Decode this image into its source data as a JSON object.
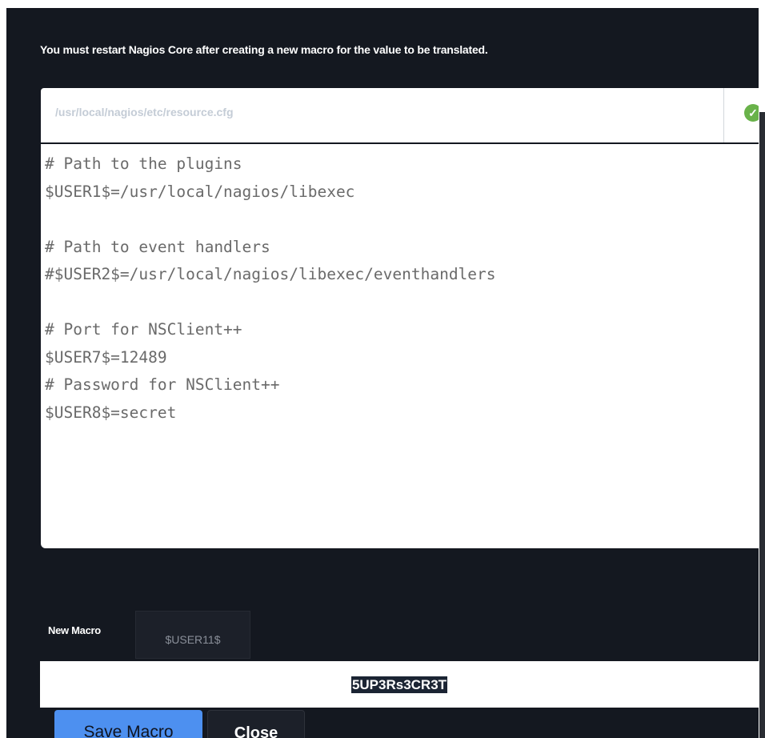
{
  "notice": "You must restart Nagios Core after creating a new macro for the value to be translated.",
  "resource_file": {
    "path": "/usr/local/nagios/etc/resource.cfg",
    "status_icon": "check-circle-icon",
    "status_color": "#69b24a"
  },
  "editor": {
    "lines": [
      "# Path to the plugins",
      "$USER1$=/usr/local/nagios/libexec",
      "",
      "# Path to event handlers",
      "#$USER2$=/usr/local/nagios/libexec/eventhandlers",
      "",
      "# Port for NSClient++",
      "$USER7$=12489",
      "# Password for NSClient++",
      "$USER8$=secret"
    ]
  },
  "new_macro": {
    "label": "New Macro",
    "name": "$USER11$",
    "value": "5UP3Rs3CR3T"
  },
  "buttons": {
    "save": "Save Macro",
    "close": "Close"
  },
  "colors": {
    "panel_bg": "#141820",
    "accent": "#4d90f0",
    "selection_bg": "#1b2433"
  }
}
